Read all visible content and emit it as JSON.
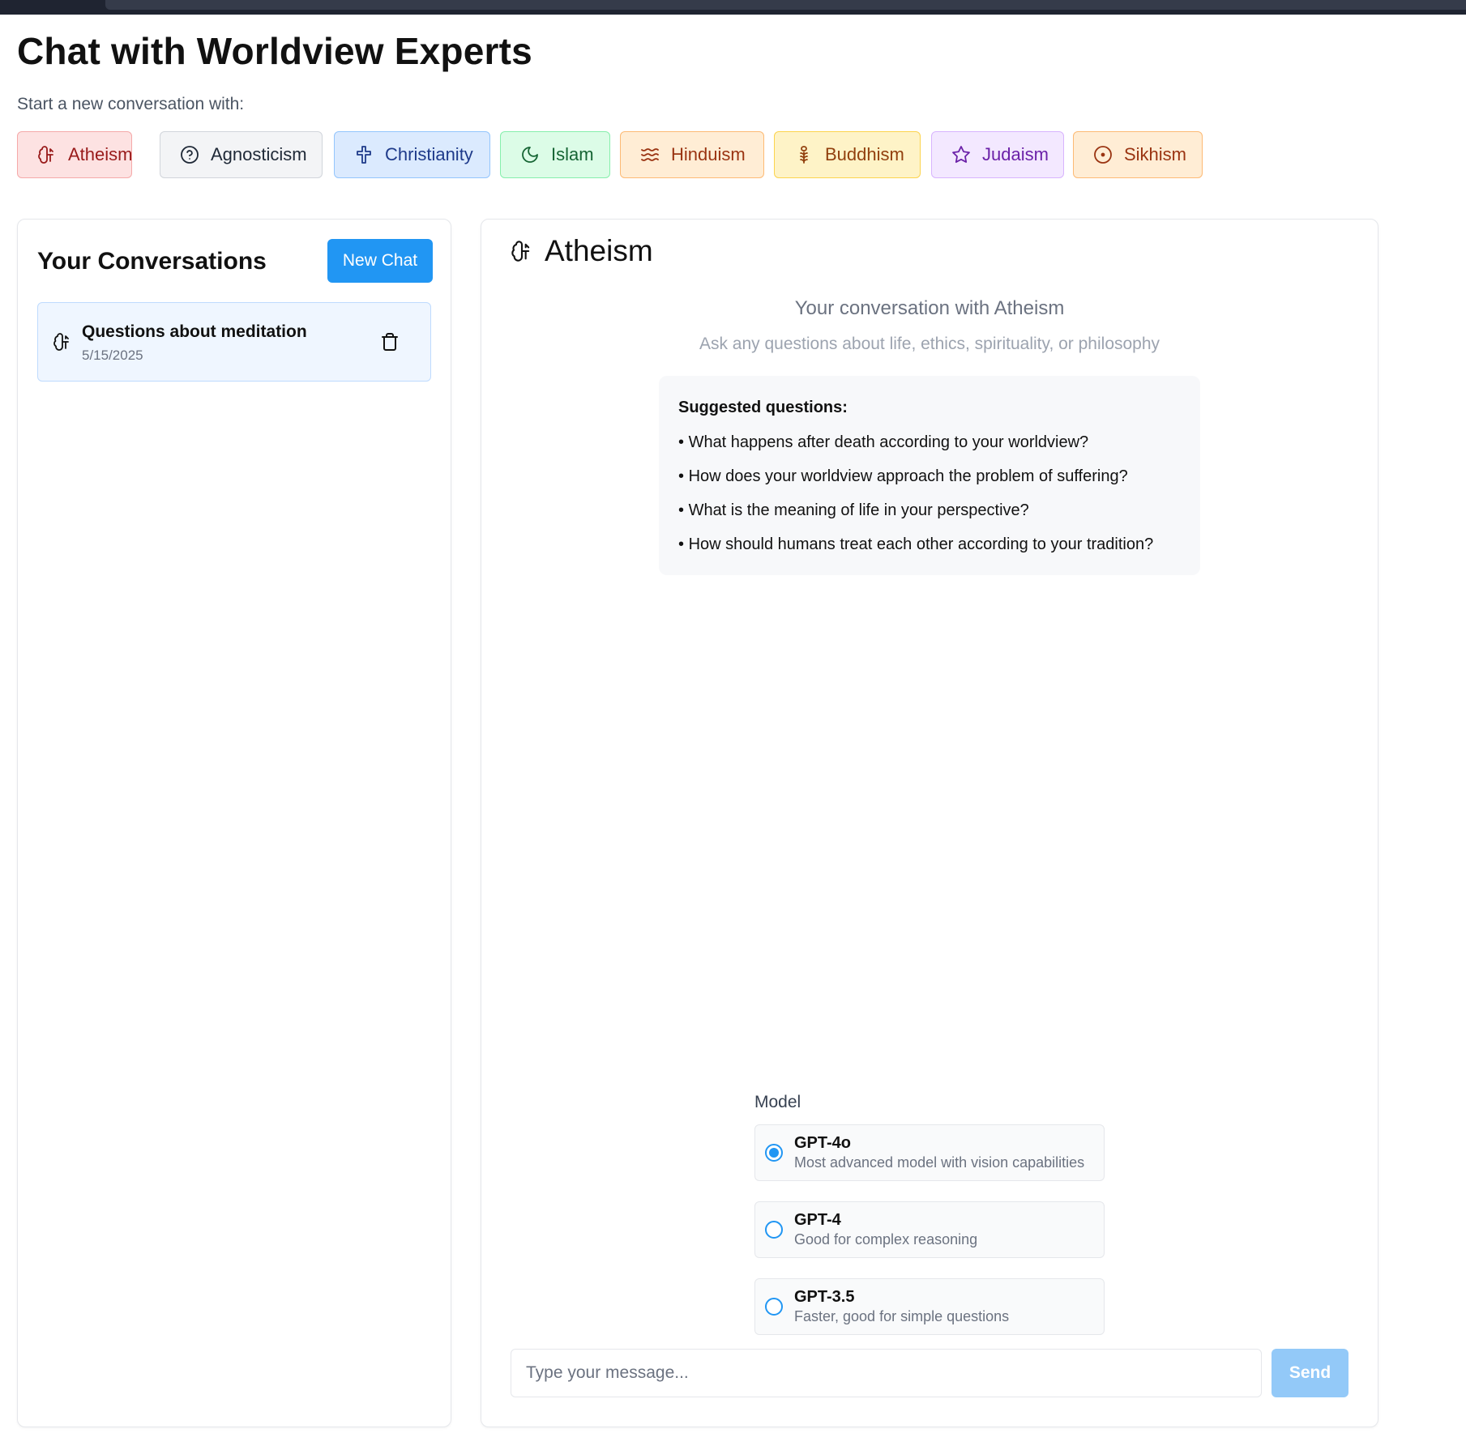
{
  "page": {
    "title": "Chat with Worldview Experts",
    "subtitle": "Start a new conversation with:"
  },
  "worldviews": [
    {
      "label": "Atheism",
      "icon": "atheism-icon",
      "bg": "#fde2e2",
      "border": "#f5a9a9",
      "color": "#991b1b"
    },
    {
      "label": "Agnosticism",
      "icon": "question-circle-icon",
      "bg": "#f3f4f6",
      "border": "#d1d5db",
      "color": "#1f2937"
    },
    {
      "label": "Christianity",
      "icon": "cross-icon",
      "bg": "#dbeafe",
      "border": "#93c5fd",
      "color": "#1e3a8a"
    },
    {
      "label": "Islam",
      "icon": "crescent-icon",
      "bg": "#dcfce7",
      "border": "#86efac",
      "color": "#166534"
    },
    {
      "label": "Hinduism",
      "icon": "waves-icon",
      "bg": "#ffedd5",
      "border": "#fdba74",
      "color": "#9a3412"
    },
    {
      "label": "Buddhism",
      "icon": "wheat-icon",
      "bg": "#fef3c7",
      "border": "#fcd34d",
      "color": "#92400e"
    },
    {
      "label": "Judaism",
      "icon": "star-icon",
      "bg": "#f3e8ff",
      "border": "#d8b4fe",
      "color": "#6b21a8"
    },
    {
      "label": "Sikhism",
      "icon": "target-circle-icon",
      "bg": "#ffedd5",
      "border": "#fdba74",
      "color": "#9a3412"
    }
  ],
  "sidebar": {
    "heading": "Your Conversations",
    "new_chat_label": "New Chat",
    "conversations": [
      {
        "title": "Questions about meditation",
        "date": "5/15/2025",
        "icon": "atheism-icon"
      }
    ]
  },
  "chat": {
    "worldview": "Atheism",
    "conversation_with": "Your conversation with Atheism",
    "hint": "Ask any questions about life, ethics, spirituality, or philosophy",
    "suggested_title": "Suggested questions:",
    "suggested": [
      "What happens after death according to your worldview?",
      "How does your worldview approach the problem of suffering?",
      "What is the meaning of life in your perspective?",
      "How should humans treat each other according to your tradition?"
    ],
    "model_label": "Model",
    "models": [
      {
        "name": "GPT-4o",
        "desc": "Most advanced model with vision capabilities",
        "selected": true
      },
      {
        "name": "GPT-4",
        "desc": "Good for complex reasoning",
        "selected": false
      },
      {
        "name": "GPT-3.5",
        "desc": "Faster, good for simple questions",
        "selected": false
      }
    ],
    "input_placeholder": "Type your message...",
    "input_value": "",
    "send_label": "Send"
  },
  "colors": {
    "primary": "#2196f3",
    "primary_disabled": "#93c9f8"
  }
}
